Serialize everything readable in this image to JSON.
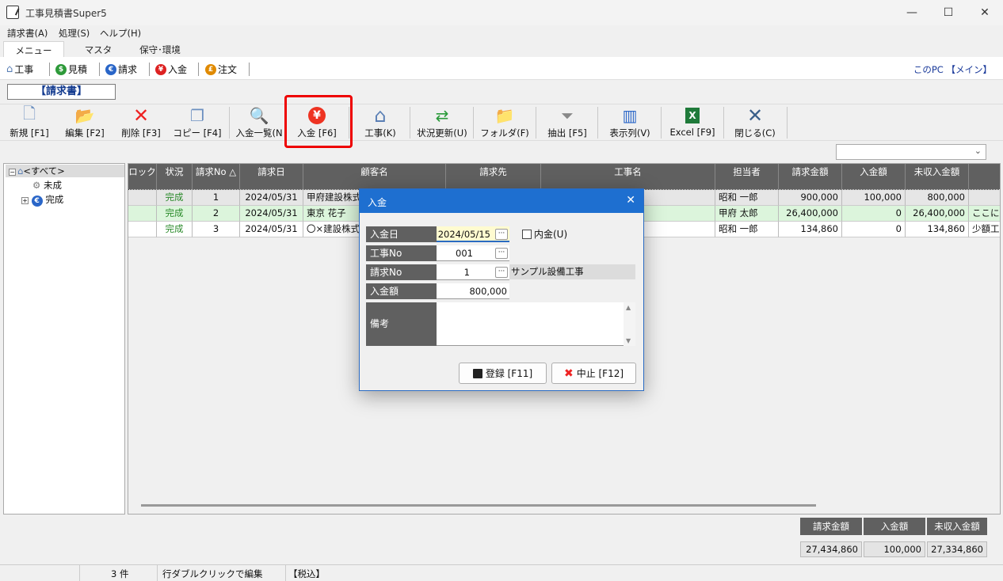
{
  "window": {
    "title": "工事見積書Super5",
    "minimize": "—",
    "maximize": "☐",
    "close": "✕"
  },
  "menu": [
    "請求書(A)",
    "処理(S)",
    "ヘルプ(H)"
  ],
  "tabs": [
    "メニュー",
    "マスタ",
    "保守･環境"
  ],
  "shortcuts": [
    {
      "label": "工事",
      "icon": "house-icon",
      "color": "#5a7fb5"
    },
    {
      "label": "見積",
      "icon": "dollar-icon",
      "color": "#2e9a3a"
    },
    {
      "label": "請求",
      "icon": "euro-icon",
      "color": "#2a66c8"
    },
    {
      "label": "入金",
      "icon": "yen-icon",
      "color": "#d22"
    },
    {
      "label": "注文",
      "icon": "pound-icon",
      "color": "#e08a00"
    }
  ],
  "pc_info": "このPC 【メイン】",
  "page_label": "【請求書】",
  "toolbar": [
    {
      "label": "新規 [F1]",
      "icon": "new-doc-icon"
    },
    {
      "label": "編集 [F2]",
      "icon": "folder-edit-icon"
    },
    {
      "label": "削除 [F3]",
      "icon": "delete-x-icon"
    },
    {
      "label": "コピー [F4]",
      "icon": "copy-icon"
    },
    {
      "label": "入金一覧(N",
      "icon": "search-doc-icon"
    },
    {
      "label": "入金 [F6]",
      "icon": "yen-icon"
    },
    {
      "label": "工事(K)",
      "icon": "house-icon"
    },
    {
      "label": "状況更新(U)",
      "icon": "refresh-icon"
    },
    {
      "label": "フォルダ(F)",
      "icon": "folder-icon"
    },
    {
      "label": "抽出 [F5]",
      "icon": "funnel-icon"
    },
    {
      "label": "表示列(V)",
      "icon": "columns-icon"
    },
    {
      "label": "Excel [F9]",
      "icon": "excel-icon"
    },
    {
      "label": "閉じる(C)",
      "icon": "close-x-icon"
    }
  ],
  "tree": {
    "root": "<すべて>",
    "children": [
      "未成",
      "完成"
    ]
  },
  "grid": {
    "headers": [
      "ロック",
      "状況",
      "請求No △",
      "請求日",
      "顧客名",
      "請求先",
      "工事名",
      "担当者",
      "請求金額",
      "入金額",
      "未収入金額",
      ""
    ],
    "rows": [
      [
        "",
        "完成",
        "1",
        "2024/05/31",
        "甲府建設株式会社",
        "",
        "",
        "昭和 一郎",
        "900,000",
        "100,000",
        "800,000",
        ""
      ],
      [
        "",
        "完成",
        "2",
        "2024/05/31",
        "東京 花子",
        "",
        "",
        "甲府 太郎",
        "26,400,000",
        "0",
        "26,400,000",
        "ここにも"
      ],
      [
        "",
        "完成",
        "3",
        "2024/05/31",
        "〇×建設株式会社",
        "",
        "",
        "昭和 一郎",
        "134,860",
        "0",
        "134,860",
        "少額工事"
      ]
    ]
  },
  "totals": {
    "headers": [
      "請求金額",
      "入金額",
      "未収入金額"
    ],
    "values": [
      "27,434,860",
      "100,000",
      "27,334,860"
    ]
  },
  "status": {
    "count": "3 件",
    "hint": "行ダブルクリックで編集",
    "tax": "【税込】"
  },
  "dialog": {
    "title": "入金",
    "close": "✕",
    "fields": {
      "date_label": "入金日",
      "date_value": "2024/05/15",
      "inner_label": "内金(U)",
      "kouji_label": "工事No",
      "kouji_value": "001",
      "seikyu_label": "請求No",
      "seikyu_value": "1",
      "seikyu_name": "サンプル設備工事",
      "amount_label": "入金額",
      "amount_value": "800,000",
      "memo_label": "備考",
      "memo_value": ""
    },
    "ok": "登録 [F11]",
    "cancel": "中止 [F12]"
  }
}
